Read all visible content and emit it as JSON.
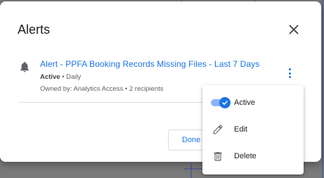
{
  "dialog": {
    "title": "Alerts",
    "close_icon": "close-icon"
  },
  "alert": {
    "icon": "bell-icon",
    "title": "Alert - PPFA Booking Records Missing Files - Last 7 Days",
    "status": "Active",
    "meta_rest": " • Daily",
    "owner": "Owned by: Analytics Access • 2 recipients",
    "menu_icon": "more-vert-icon"
  },
  "footer": {
    "done_label": "Done"
  },
  "context_menu": {
    "items": [
      {
        "label": "Active",
        "icon": "toggle-on-check-icon"
      },
      {
        "label": "Edit",
        "icon": "pencil-icon"
      },
      {
        "label": "Delete",
        "icon": "trash-icon"
      }
    ]
  },
  "colors": {
    "accent": "#1a73e8",
    "backdrop": "#7a7a7a",
    "text_primary": "#202124",
    "text_secondary": "#5f6368"
  }
}
